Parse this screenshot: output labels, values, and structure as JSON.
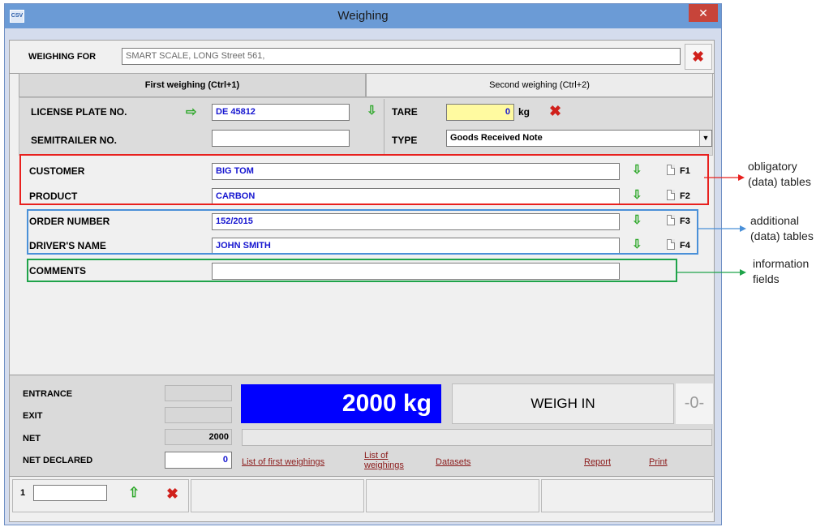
{
  "window": {
    "title": "Weighing",
    "icon_text": "CSV"
  },
  "header": {
    "label": "WEIGHING FOR",
    "value": "SMART SCALE, LONG Street 561,"
  },
  "tabs": [
    {
      "label": "First weighing (Ctrl+1)",
      "active": true
    },
    {
      "label": "Second weighing (Ctrl+2)",
      "active": false
    }
  ],
  "vehicle": {
    "license_label": "LICENSE PLATE NO.",
    "license_value": "DE 45812",
    "semitrailer_label": "SEMITRAILER NO.",
    "semitrailer_value": "",
    "tare_label": "TARE",
    "tare_value": "0",
    "tare_unit": "kg",
    "type_label": "TYPE",
    "type_value": "Goods Received Note"
  },
  "data_rows": [
    {
      "label": "CUSTOMER",
      "value": "BIG TOM",
      "key": "F1"
    },
    {
      "label": "PRODUCT",
      "value": "CARBON",
      "key": "F2"
    },
    {
      "label": "ORDER NUMBER",
      "value": "152/2015",
      "key": "F3"
    },
    {
      "label": "DRIVER'S NAME",
      "value": "JOHN SMITH",
      "key": "F4"
    }
  ],
  "comments": {
    "label": "COMMENTS",
    "value": ""
  },
  "weights": {
    "entrance_label": "ENTRANCE",
    "exit_label": "EXIT",
    "net_label": "NET",
    "net_value": "2000",
    "net_declared_label": "NET DECLARED",
    "net_declared_value": "0",
    "display": "2000 kg",
    "weigh_in_label": "WEIGH IN",
    "zero_indicator": "-0-"
  },
  "links": {
    "first_weighings": "List of first weighings",
    "weighings_line1": "List of",
    "weighings_line2": "weighings",
    "datasets": "Datasets",
    "report": "Report",
    "print": "Print"
  },
  "footer": {
    "page_number": "1",
    "page_value": ""
  },
  "annotations": {
    "obligatory_line1": "obligatory",
    "obligatory_line2": "(data) tables",
    "additional_line1": "additional",
    "additional_line2": "(data) tables",
    "info_line1": "information",
    "info_line2": "fields"
  },
  "colors": {
    "titlebar": "#6b9bd6",
    "display_bg": "#0000ff",
    "obligatory": "#e8201e",
    "additional": "#4a90d8",
    "information": "#1fa34a",
    "link": "#8b1a1a"
  }
}
